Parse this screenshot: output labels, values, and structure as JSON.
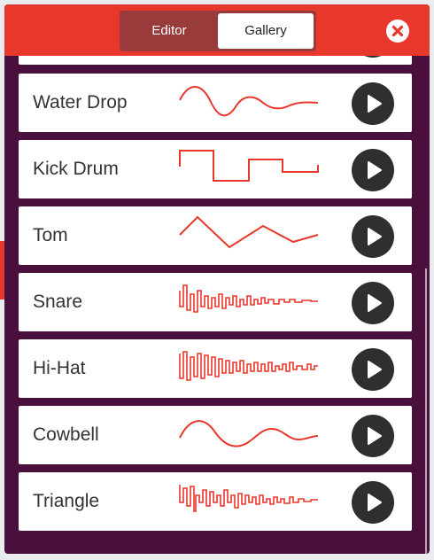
{
  "header": {
    "tabs": [
      {
        "label": "Editor",
        "active": false
      },
      {
        "label": "Gallery",
        "active": true
      }
    ],
    "close_icon": "close-x-icon"
  },
  "colors": {
    "accent": "#e8372b",
    "dialog_bg": "#4a0f3c",
    "wave": "#e8372b",
    "play_button": "#2f2f2f"
  },
  "sounds": [
    {
      "label": "Water Drop",
      "waveform": "sine-decay"
    },
    {
      "label": "Kick Drum",
      "waveform": "square-step"
    },
    {
      "label": "Tom",
      "waveform": "triangle"
    },
    {
      "label": "Snare",
      "waveform": "noise-decay"
    },
    {
      "label": "Hi-Hat",
      "waveform": "noise-decay"
    },
    {
      "label": "Cowbell",
      "waveform": "sine-decay"
    },
    {
      "label": "Triangle",
      "waveform": "noise-decay"
    }
  ],
  "play_icon": "play-icon"
}
